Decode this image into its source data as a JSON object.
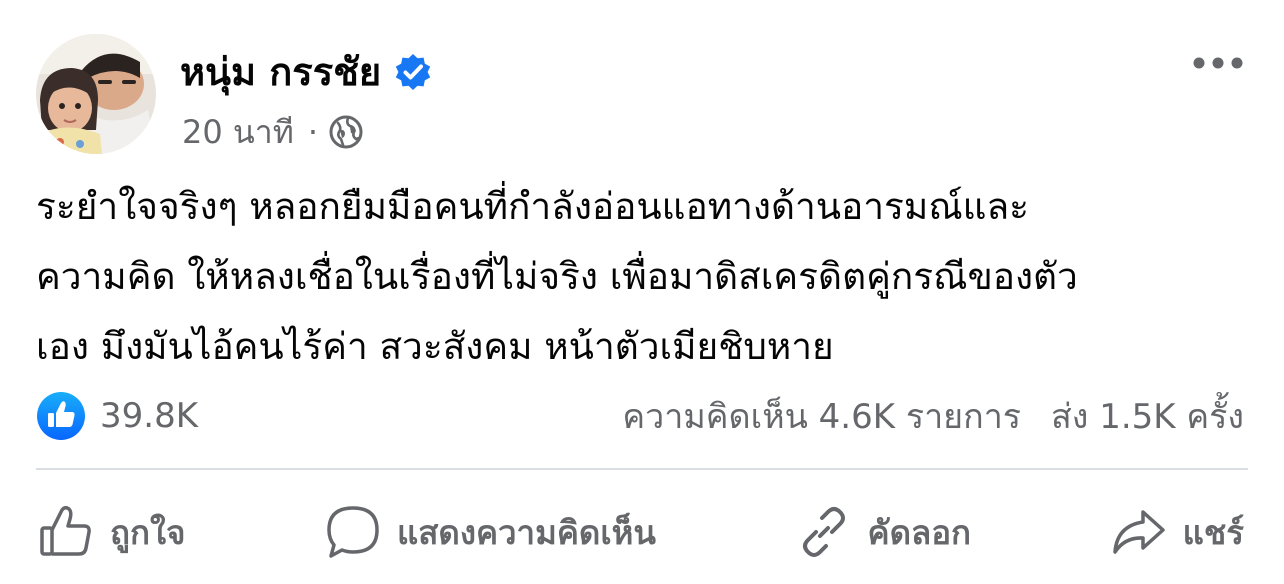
{
  "post": {
    "author": "หนุ่ม กรรชัย",
    "time": "20 นาที",
    "separator": "·",
    "text": "ระยำใจจริงๆ หลอกยืมมือคนที่กำลังอ่อนแอทางด้านอารมณ์และ\nความคิด ให้หลงเชื่อในเรื่องที่ไม่จริง เพื่อมาดิสเครดิตคู่กรณีของตัว\nเอง มึงมันไอ้คนไร้ค่า สวะสังคม หน้าตัวเมียชิบหาย",
    "verified": true,
    "privacy_icon": "globe-icon"
  },
  "stats": {
    "reactions": "39.8K",
    "comments": "ความคิดเห็น 4.6K รายการ",
    "shares": "ส่ง 1.5K ครั้ง"
  },
  "actions": {
    "like": "ถูกใจ",
    "comment": "แสดงความคิดเห็น",
    "copy": "คัดลอก",
    "share": "แชร์"
  },
  "colors": {
    "accent": "#1877f2",
    "secondary_text": "#65676b",
    "divider": "#dadde1"
  }
}
